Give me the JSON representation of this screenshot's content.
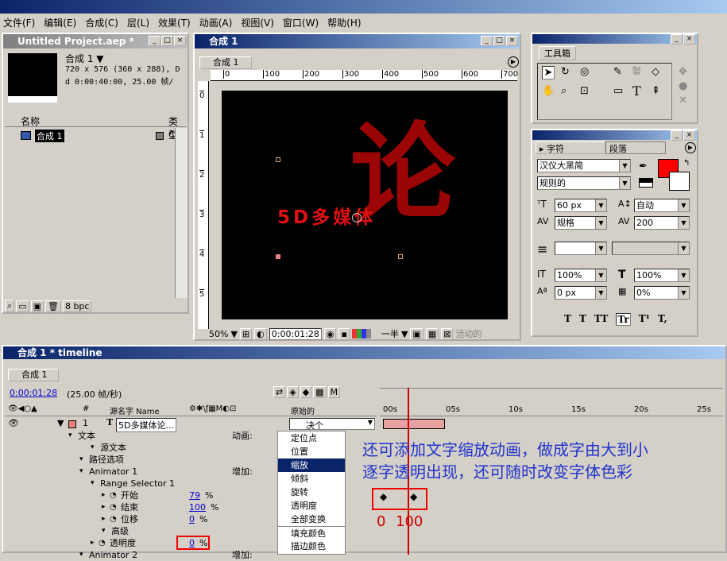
{
  "menubar": [
    "文件(F)",
    "编辑(E)",
    "合成(C)",
    "层(L)",
    "效果(T)",
    "动画(A)",
    "视图(V)",
    "窗口(W)",
    "帮助(H)"
  ],
  "project": {
    "title": "Untitled Project.aep *",
    "comp_name": "合成 1 ▼",
    "comp_size": "720 x 576  (360 x 288), D",
    "comp_duration": "d 0:00:40:00, 25.00 帧/",
    "col_name": "名称",
    "col_type": "类型",
    "item_name": "合成 1",
    "item_type": "C",
    "bpc": "8 bpc"
  },
  "comp": {
    "title": "合成 1",
    "tab": "合成 1",
    "ruler_labels": [
      "0",
      "100",
      "200",
      "300",
      "400",
      "500",
      "600",
      "700"
    ],
    "vruler_labels": [
      "0",
      "1",
      "2",
      "3",
      "4",
      "5"
    ],
    "big_char": "论",
    "text_layer": "5D多媒体",
    "zoom": "50%",
    "timecode": "0:00:01:28",
    "resolution": "一半",
    "active_cam": "活动的"
  },
  "tools": {
    "title": "工具箱"
  },
  "character": {
    "tab1": "字符",
    "tab2": "段落",
    "font": "汉仪大黑简",
    "style": "规则的",
    "size": "60 px",
    "leading": "自动",
    "kerning": "规格",
    "tracking": "200",
    "vscale": "100%",
    "hscale": "100%",
    "baseline": "0 px",
    "tsume": "0%",
    "fill_color": "#ff0000",
    "styles": [
      "T",
      "T",
      "TT",
      "Tr",
      "T¹",
      "T,"
    ]
  },
  "timeline": {
    "title": "合成 1 * timeline",
    "tab": "合成 1",
    "timecode": "0:00:01:28",
    "fps": "(25.00 帧/秒)",
    "col_num": "#",
    "col_source": "源名字 Name",
    "col_parent": "原始的",
    "parent_val": "决个",
    "time_ticks": [
      "00s",
      "05s",
      "10s",
      "15s",
      "20s",
      "25s"
    ],
    "layer_num": "1",
    "layer_name": "5D多媒体论...",
    "rows": [
      {
        "label": "文本",
        "indent": 1,
        "right": "动画:"
      },
      {
        "label": "源文本",
        "indent": 3,
        "right": ""
      },
      {
        "label": "路径选项",
        "indent": 2,
        "right": ""
      },
      {
        "label": "Animator 1",
        "indent": 2,
        "right": "增加:"
      },
      {
        "label": "Range Selector 1",
        "indent": 3,
        "right": ""
      },
      {
        "label": "开始",
        "indent": 4,
        "value": "79",
        "unit": "%"
      },
      {
        "label": "结束",
        "indent": 4,
        "value": "100",
        "unit": "%"
      },
      {
        "label": "位移",
        "indent": 4,
        "value": "0",
        "unit": "%"
      },
      {
        "label": "高级",
        "indent": 4,
        "right": ""
      },
      {
        "label": "透明度",
        "indent": 3,
        "value": "0",
        "unit": "%"
      },
      {
        "label": "Animator 2",
        "indent": 2,
        "right": "增加:"
      }
    ],
    "context_menu": [
      "定位点",
      "位置",
      "缩放",
      "倾斜",
      "旋转",
      "透明度",
      "全部变换",
      "填充颜色",
      "描边颜色"
    ],
    "selected_menu": "缩放",
    "annotation_line1": "还可添加文字缩放动画，做成字由大到小",
    "annotation_line2": "逐字透明出现，还可随时改变字体色彩",
    "kf_label_0": "0",
    "kf_label_100": "100"
  }
}
